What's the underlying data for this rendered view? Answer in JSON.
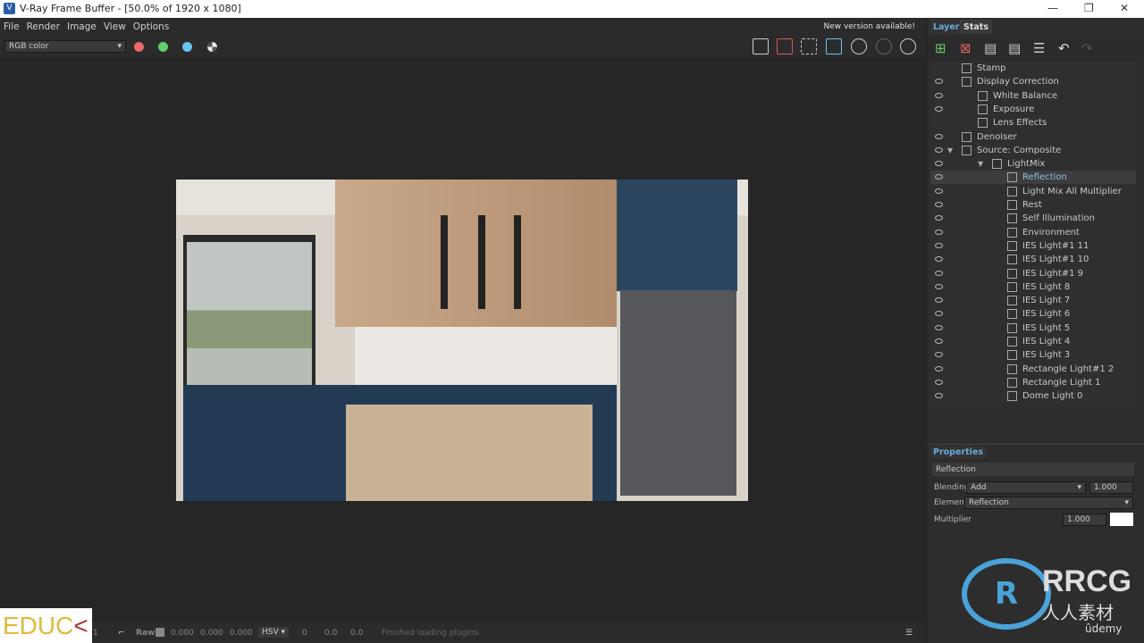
{
  "window": {
    "title": "V-Ray Frame Buffer - [50.0% of 1920 x 1080]",
    "min": "—",
    "max": "❐",
    "close": "✕"
  },
  "menu": [
    "File",
    "Render",
    "Image",
    "View",
    "Options"
  ],
  "new_version": "New version available!",
  "toolbar": {
    "channel": "RGB color",
    "colors": {
      "red": "#e86a6a",
      "green": "#5fcf6a",
      "blue": "#6cc4f0"
    }
  },
  "layers_panel": {
    "tabs": [
      "Layers",
      "Stats"
    ],
    "layers": [
      {
        "label": "Stamp",
        "level": 0,
        "eye": false
      },
      {
        "label": "Display Correction",
        "level": 0,
        "eye": true
      },
      {
        "label": "White Balance",
        "level": 1,
        "eye": true
      },
      {
        "label": "Exposure",
        "level": 1,
        "eye": true
      },
      {
        "label": "Lens Effects",
        "level": 1,
        "eye": false
      },
      {
        "label": "Denoiser",
        "level": 0,
        "eye": true
      },
      {
        "label": "Source: Composite",
        "level": 0,
        "eye": true,
        "expanded": true
      },
      {
        "label": "LightMix",
        "level": 2,
        "eye": true,
        "expanded": true
      },
      {
        "label": "Reflection",
        "level": 3,
        "eye": true,
        "selected": true
      },
      {
        "label": "Light Mix All Multiplier",
        "level": 3,
        "eye": true
      },
      {
        "label": "Rest",
        "level": 3,
        "eye": true
      },
      {
        "label": "Self Illumination",
        "level": 3,
        "eye": true
      },
      {
        "label": "Environment",
        "level": 3,
        "eye": true
      },
      {
        "label": "IES Light#1 11",
        "level": 3,
        "eye": true
      },
      {
        "label": "IES Light#1 10",
        "level": 3,
        "eye": true
      },
      {
        "label": "IES Light#1 9",
        "level": 3,
        "eye": true
      },
      {
        "label": "IES Light 8",
        "level": 3,
        "eye": true
      },
      {
        "label": "IES Light 7",
        "level": 3,
        "eye": true
      },
      {
        "label": "IES Light 6",
        "level": 3,
        "eye": true
      },
      {
        "label": "IES Light 5",
        "level": 3,
        "eye": true
      },
      {
        "label": "IES Light 4",
        "level": 3,
        "eye": true
      },
      {
        "label": "IES Light 3",
        "level": 3,
        "eye": true
      },
      {
        "label": "Rectangle Light#1 2",
        "level": 3,
        "eye": true
      },
      {
        "label": "Rectangle Light 1",
        "level": 3,
        "eye": true
      },
      {
        "label": "Dome Light 0",
        "level": 3,
        "eye": true
      }
    ]
  },
  "properties": {
    "title": "Properties",
    "name": "Reflection",
    "blending_label": "Blending",
    "blending": "Add",
    "blending_value": "1.000",
    "element_label": "Element",
    "element": "Reflection",
    "multiplier_label": "Multiplier",
    "multiplier": "1.000",
    "color": "#ffffff"
  },
  "status": {
    "zoom": "1",
    "raw": "Raw",
    "r": "0.000",
    "g": "0.000",
    "b": "0.000",
    "mode": "HSV",
    "h": "0",
    "s": "0.0",
    "v": "0.0",
    "message": "Finished loading plugins."
  },
  "watermarks": {
    "edu": "EDUC",
    "rrcg": "RRCG",
    "rrcg_sub": "人人素材",
    "udemy": "ûdemy"
  }
}
